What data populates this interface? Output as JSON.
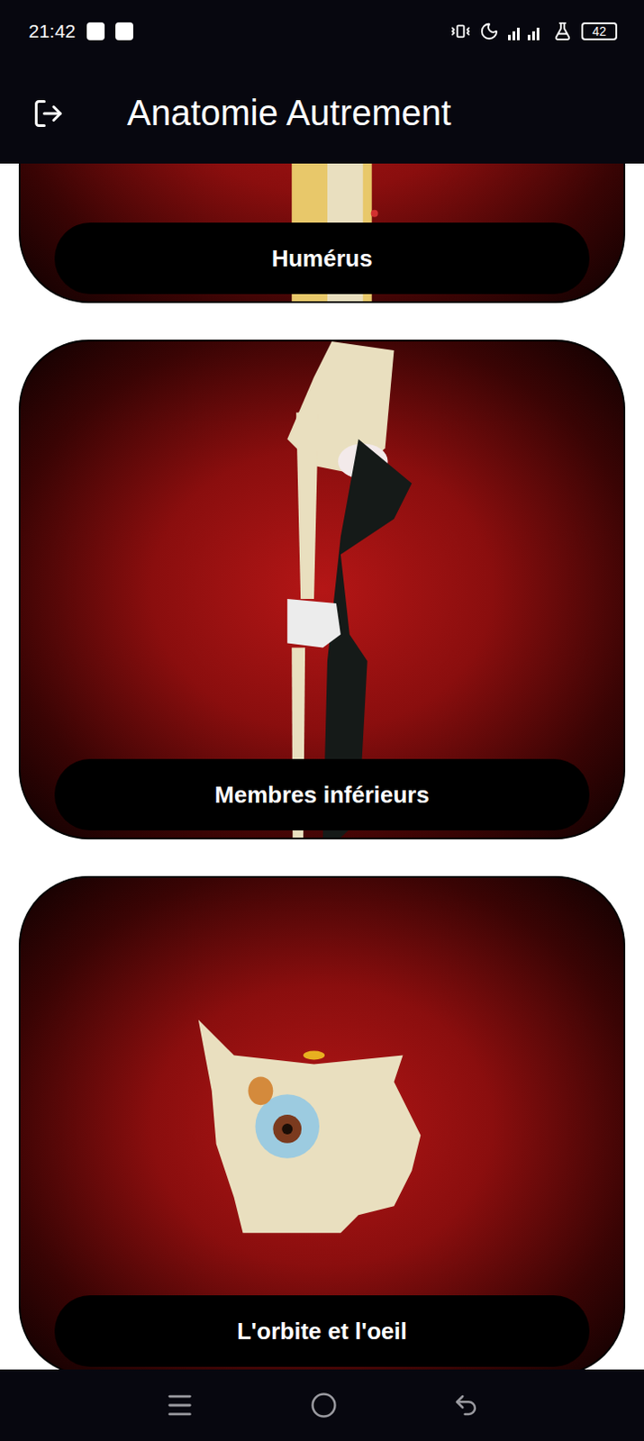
{
  "status_bar": {
    "time": "21:42",
    "battery": "42"
  },
  "app_bar": {
    "title": "Anatomie Autrement"
  },
  "cards": [
    {
      "label": "Humérus",
      "kind": "humerus"
    },
    {
      "label": "Membres inférieurs",
      "kind": "leg"
    },
    {
      "label": "L'orbite et l'oeil",
      "kind": "orbit"
    }
  ]
}
